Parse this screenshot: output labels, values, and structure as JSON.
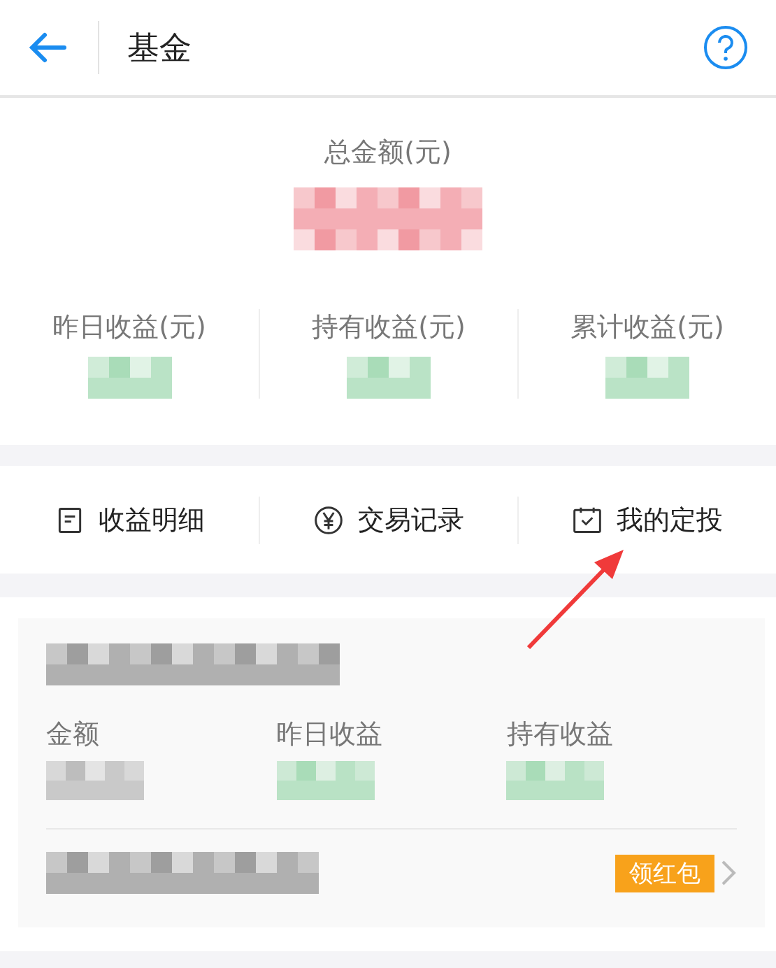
{
  "header": {
    "title": "基金"
  },
  "summary": {
    "total_label": "总金额(元)",
    "stats": [
      {
        "label": "昨日收益(元)",
        "color": "#a9dcb8"
      },
      {
        "label": "持有收益(元)",
        "color": "#a9dcb8"
      },
      {
        "label": "累计收益(元)",
        "color": "#a9dcb8"
      }
    ]
  },
  "actions": [
    {
      "label": "收益明细",
      "kind": "document"
    },
    {
      "label": "交易记录",
      "kind": "yen"
    },
    {
      "label": "我的定投",
      "kind": "calendar"
    }
  ],
  "fund_card": {
    "columns": [
      {
        "label": "金额",
        "color": "#bdbdbd"
      },
      {
        "label": "昨日收益",
        "color": "#a9dcb8"
      },
      {
        "label": "持有收益",
        "color": "#a9dcb8"
      }
    ],
    "badge": "领红包"
  }
}
